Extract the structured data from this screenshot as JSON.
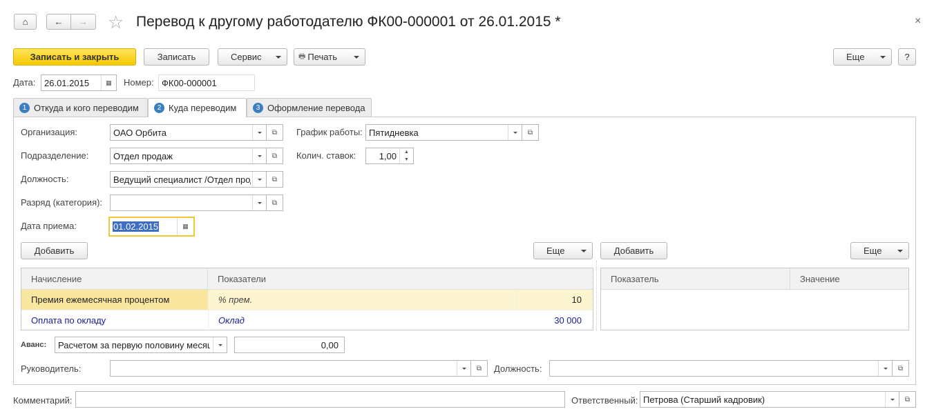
{
  "header": {
    "title": "Перевод к другому работодателю ФК00-000001 от 26.01.2015 *",
    "close": "×"
  },
  "toolbar": {
    "save_close": "Записать и закрыть",
    "save": "Записать",
    "service": "Сервис",
    "print": "Печать",
    "more": "Еще",
    "help": "?"
  },
  "doc": {
    "date_label": "Дата:",
    "date": "26.01.2015",
    "number_label": "Номер:",
    "number": "ФК00-000001"
  },
  "tabs": [
    {
      "num": "1",
      "label": "Откуда и кого переводим"
    },
    {
      "num": "2",
      "label": "Куда переводим"
    },
    {
      "num": "3",
      "label": "Оформление перевода"
    }
  ],
  "form": {
    "org_label": "Организация:",
    "org": "ОАО Орбита",
    "dept_label": "Подразделение:",
    "dept": "Отдел продаж",
    "pos_label": "Должность:",
    "pos": "Ведущий специалист /Отдел продаж/",
    "grade_label": "Разряд (категория):",
    "grade": "",
    "hire_label": "Дата приема:",
    "hire": "01.02.2015",
    "schedule_label": "График работы:",
    "schedule": "Пятидневка",
    "rate_label": "Колич. ставок:",
    "rate": "1,00"
  },
  "accruals": {
    "add": "Добавить",
    "more": "Еще",
    "headers": [
      "Начисление",
      "Показатели"
    ],
    "rows": [
      {
        "name": "Премия ежемесячная процентом",
        "indicator": "% прем.",
        "value": "10"
      },
      {
        "name": "Оплата по окладу",
        "indicator": "Оклад",
        "value": "30 000"
      }
    ]
  },
  "indicators": {
    "add": "Добавить",
    "more": "Еще",
    "headers": [
      "Показатель",
      "Значение"
    ]
  },
  "advance": {
    "label": "Аванс:",
    "method": "Расчетом за первую половину месяца",
    "amount": "0,00"
  },
  "manager": {
    "label": "Руководитель:",
    "value": "",
    "pos_label": "Должность:",
    "pos": ""
  },
  "footer": {
    "comment_label": "Комментарий:",
    "comment": "",
    "resp_label": "Ответственный:",
    "resp": "Петрова (Старший кадровик)"
  }
}
